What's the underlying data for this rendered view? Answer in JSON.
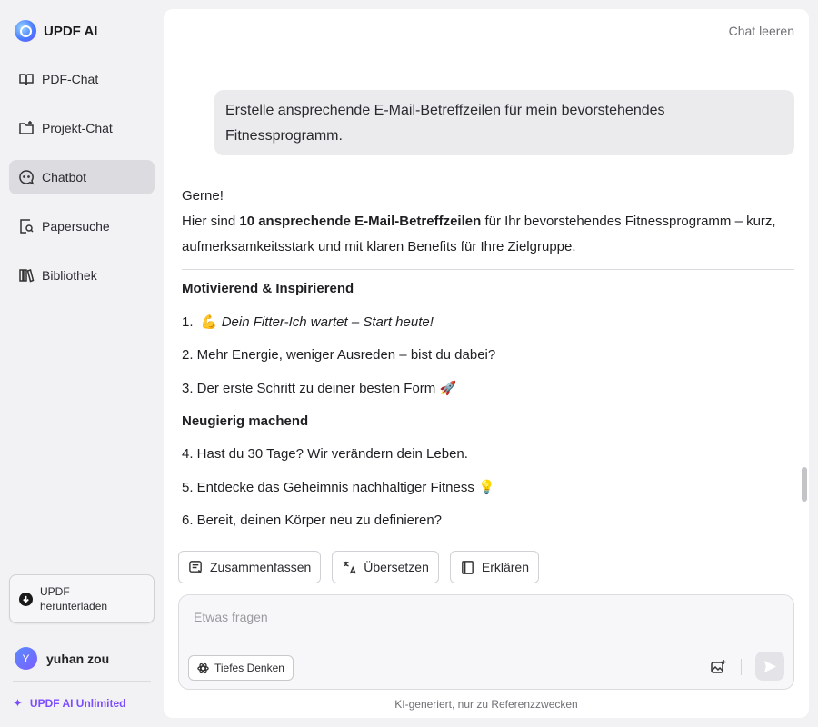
{
  "brand": {
    "name": "UPDF AI"
  },
  "sidebar": {
    "items": [
      {
        "label": "PDF-Chat",
        "icon": "book-open-icon",
        "active": false
      },
      {
        "label": "Projekt-Chat",
        "icon": "folder-plus-icon",
        "active": false
      },
      {
        "label": "Chatbot",
        "icon": "chatbot-icon",
        "active": true
      },
      {
        "label": "Papersuche",
        "icon": "search-doc-icon",
        "active": false
      },
      {
        "label": "Bibliothek",
        "icon": "library-icon",
        "active": false
      }
    ],
    "download": {
      "line1": "UPDF",
      "line2": "herunterladen"
    },
    "user": {
      "initial": "Y",
      "name": "yuhan zou"
    },
    "unlimited_label": "UPDF AI Unlimited"
  },
  "header": {
    "clear_label": "Chat leeren"
  },
  "conversation": {
    "user_message": "Erstelle ansprechende E-Mail-Betreffzeilen für mein bevorstehendes Fitnessprogramm.",
    "answer": {
      "greeting": "Gerne!",
      "intro_prefix": "Hier sind ",
      "intro_bold": "10 ansprechende E-Mail-Betreffzeilen",
      "intro_suffix": " für Ihr bevorstehendes Fitnessprogramm – kurz, aufmerksamkeitsstark und mit klaren Benefits für Ihre Zielgruppe.",
      "section1_heading": "Motivierend & Inspirierend",
      "item1_num": "1.",
      "item1_emoji": "💪",
      "item1_text": "Dein Fitter-Ich wartet – Start heute!",
      "item2": "2. Mehr Energie, weniger Ausreden – bist du dabei?",
      "item3_text": "3. Der erste Schritt zu deiner besten Form",
      "item3_emoji": "🚀",
      "section2_heading": "Neugierig machend",
      "item4": "4. Hast du 30 Tage? Wir verändern dein Leben.",
      "item5_text": "5. Entdecke das Geheimnis nachhaltiger Fitness",
      "item5_emoji": "💡",
      "item6": "6. Bereit, deinen Körper neu zu definieren?"
    }
  },
  "actions": {
    "summarize": "Zusammenfassen",
    "translate": "Übersetzen",
    "explain": "Erklären"
  },
  "composer": {
    "placeholder": "Etwas fragen",
    "deep_think_label": "Tiefes Denken"
  },
  "footer": {
    "disclaimer": "KI-generiert, nur zu Referenzzwecken"
  }
}
